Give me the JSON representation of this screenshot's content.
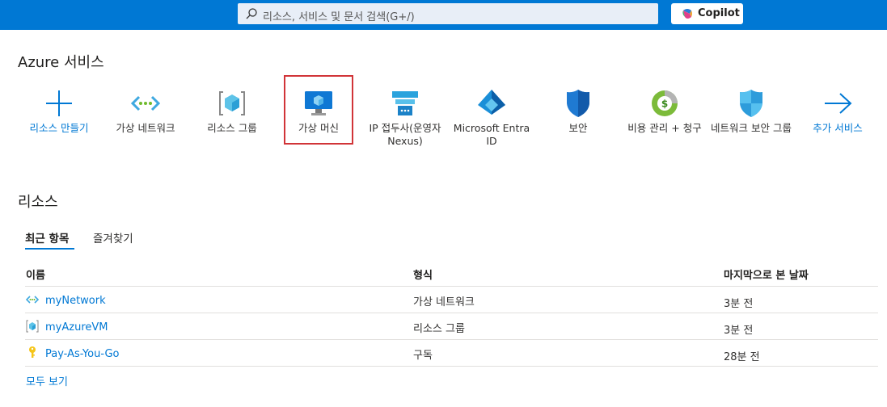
{
  "topbar": {
    "search_placeholder": "리소스, 서비스 및 문서 검색(G+/)",
    "copilot_label": "Copilot"
  },
  "services": {
    "heading": "Azure 서비스",
    "items": [
      {
        "label": "리소스 만들기",
        "icon": "plus-icon"
      },
      {
        "label": "가상 네트워크",
        "icon": "virtual-network-icon"
      },
      {
        "label": "리소스 그룹",
        "icon": "resource-group-icon"
      },
      {
        "label": "가상 머신",
        "icon": "virtual-machine-icon"
      },
      {
        "label": "IP 접두사(운영자 Nexus)",
        "icon": "ip-prefix-icon"
      },
      {
        "label": "Microsoft Entra ID",
        "icon": "entra-id-icon"
      },
      {
        "label": "보안",
        "icon": "security-shield-icon"
      },
      {
        "label": "비용 관리 + 청구",
        "icon": "cost-management-icon"
      },
      {
        "label": "네트워크 보안 그룹",
        "icon": "network-security-group-icon"
      },
      {
        "label": "추가 서비스",
        "icon": "arrow-right-icon"
      }
    ]
  },
  "resources": {
    "heading": "리소스",
    "tabs": [
      "최근 항목",
      "즐겨찾기"
    ],
    "columns": [
      "이름",
      "형식",
      "마지막으로 본 날짜"
    ],
    "rows": [
      {
        "name": "myNetwork",
        "type": "가상 네트워크",
        "last_viewed": "3분 전",
        "icon": "virtual-network-icon"
      },
      {
        "name": "myAzureVM",
        "type": "리소스 그룹",
        "last_viewed": "3분 전",
        "icon": "resource-group-icon"
      },
      {
        "name": "Pay-As-You-Go",
        "type": "구독",
        "last_viewed": "28분 전",
        "icon": "subscription-key-icon"
      }
    ],
    "see_all": "모두 보기"
  },
  "colors": {
    "accent": "#0078d4",
    "topbar": "#0078d4",
    "selection": "#d13438"
  }
}
